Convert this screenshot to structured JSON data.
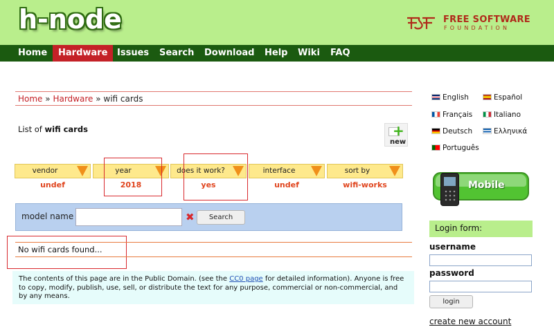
{
  "header": {
    "logo_text": "h-node",
    "fsf_top": "FREE SOFTWARE",
    "fsf_bottom": "FOUNDATION",
    "fsf_logo_icon": "fsf-logo-icon",
    "background": "#b9ee8c"
  },
  "nav": {
    "items": [
      {
        "label": "Home",
        "active": false
      },
      {
        "label": "Hardware",
        "active": true
      },
      {
        "label": "Issues",
        "active": false
      },
      {
        "label": "Search",
        "active": false
      },
      {
        "label": "Download",
        "active": false
      },
      {
        "label": "Help",
        "active": false
      },
      {
        "label": "Wiki",
        "active": false
      },
      {
        "label": "FAQ",
        "active": false
      }
    ],
    "background": "#1b5a10",
    "active_color": "#c42127"
  },
  "breadcrumb": {
    "home": "Home",
    "sep": "»",
    "hardware": "Hardware",
    "current": "wifi cards"
  },
  "list_heading": {
    "prefix": "List of",
    "bold": "wifi cards"
  },
  "new_button": {
    "label": "new",
    "icon": "add-document-icon"
  },
  "filters": [
    {
      "label": "vendor",
      "value": "undef"
    },
    {
      "label": "year",
      "value": "2018"
    },
    {
      "label": "does it work?",
      "value": "yes"
    },
    {
      "label": "interface",
      "value": "undef"
    },
    {
      "label": "sort by",
      "value": "wifi-works"
    }
  ],
  "search": {
    "label": "model name",
    "value": "",
    "clear_icon": "close-icon",
    "button": "Search"
  },
  "results": {
    "message": "No wifi cards found..."
  },
  "license": {
    "before": "The contents of this page are in the Public Domain. (see the ",
    "link": "CC0 page",
    "after": " for detailed information). Anyone is free to copy, modify, publish, use, sell, or distribute the text for any purpose, commercial or non-commercial, and by any means."
  },
  "languages": [
    {
      "label": "English",
      "flag_colors": [
        "#c8102e",
        "#ffffff",
        "#012169"
      ]
    },
    {
      "label": "Español",
      "flag_colors": [
        "#aa151b",
        "#f1bf00",
        "#aa151b"
      ]
    },
    {
      "label": "Français",
      "flag_colors": [
        "#0055a4",
        "#ffffff",
        "#ef4135"
      ]
    },
    {
      "label": "Italiano",
      "flag_colors": [
        "#009246",
        "#ffffff",
        "#ce2b37"
      ]
    },
    {
      "label": "Deutsch",
      "flag_colors": [
        "#000000",
        "#dd0000",
        "#ffce00"
      ]
    },
    {
      "label": "Ελληνικά",
      "flag_colors": [
        "#0d5eaf",
        "#ffffff",
        "#0d5eaf"
      ]
    },
    {
      "label": "Português",
      "flag_colors": [
        "#006600",
        "#ff0000",
        "#ff0000"
      ]
    }
  ],
  "mobile": {
    "label": "Mobile",
    "icon": "mobile-phone-icon"
  },
  "login": {
    "heading": "Login form:",
    "username_label": "username",
    "username_value": "",
    "password_label": "password",
    "password_value": "",
    "button": "login",
    "create_account": "create new account"
  }
}
